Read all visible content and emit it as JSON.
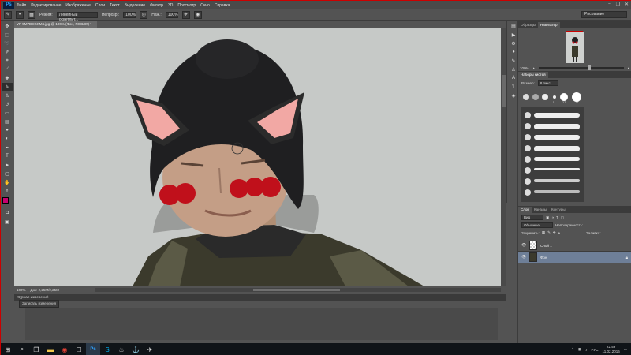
{
  "menubar": {
    "logo": "Ps",
    "items": [
      "Файл",
      "Редактирование",
      "Изображение",
      "Слои",
      "Текст",
      "Выделение",
      "Фильтр",
      "3D",
      "Просмотр",
      "Окно",
      "Справка"
    ]
  },
  "window_controls": [
    "–",
    "❐",
    "✕"
  ],
  "options_bar": {
    "mode_label": "Режим:",
    "mode_value": "Линейный осветлит...",
    "opacity_label": "Непрозр.:",
    "opacity_value": "100%",
    "flow_label": "Наж.:",
    "flow_value": "100%"
  },
  "workspace": "Рисование",
  "document": {
    "tab_title": "VF-5M7DEGXM4.jpg @ 100% (Фон, RGB/8#) *",
    "zoom": "100%",
    "doc_info": "Док: 2,25М/2,25М"
  },
  "history_panel": {
    "title": "Журнал измерений",
    "button": "Записать измерения"
  },
  "navigator": {
    "tabs": [
      "Образцы",
      "Навигатор"
    ],
    "zoom": "100%",
    "zoom_fraction": 0.6
  },
  "brush_presets": {
    "title": "Наборы кистей",
    "size_label": "Размер:",
    "size_value": "8 пикс.",
    "sizes": [
      "5",
      "17",
      "17"
    ]
  },
  "layers": {
    "tabs": [
      "Слои",
      "Каналы",
      "Контуры"
    ],
    "filter_label": "Вид",
    "blend_mode": "Обычные",
    "opacity_label": "Непрозрачность:",
    "lock_label": "Закрепить:",
    "fill_label": "Заливка:",
    "items": [
      {
        "name": "Слой 1"
      },
      {
        "name": "Фон"
      }
    ]
  },
  "taskbar": {
    "items": [
      "start-icon",
      "search-icon",
      "task-view-icon",
      "explorer-icon",
      "chrome-icon",
      "photoshop-icon",
      "skype-icon",
      "steam-icon",
      "app-icon",
      "app2-icon"
    ],
    "language": "РУС",
    "time": "22:59",
    "date": "11.02.2016"
  },
  "colors": {
    "accent": "#cc0000",
    "foreground_swatch": "#c8006e",
    "background_swatch": "#f5d800",
    "layer_selected": "#6e7f98"
  }
}
